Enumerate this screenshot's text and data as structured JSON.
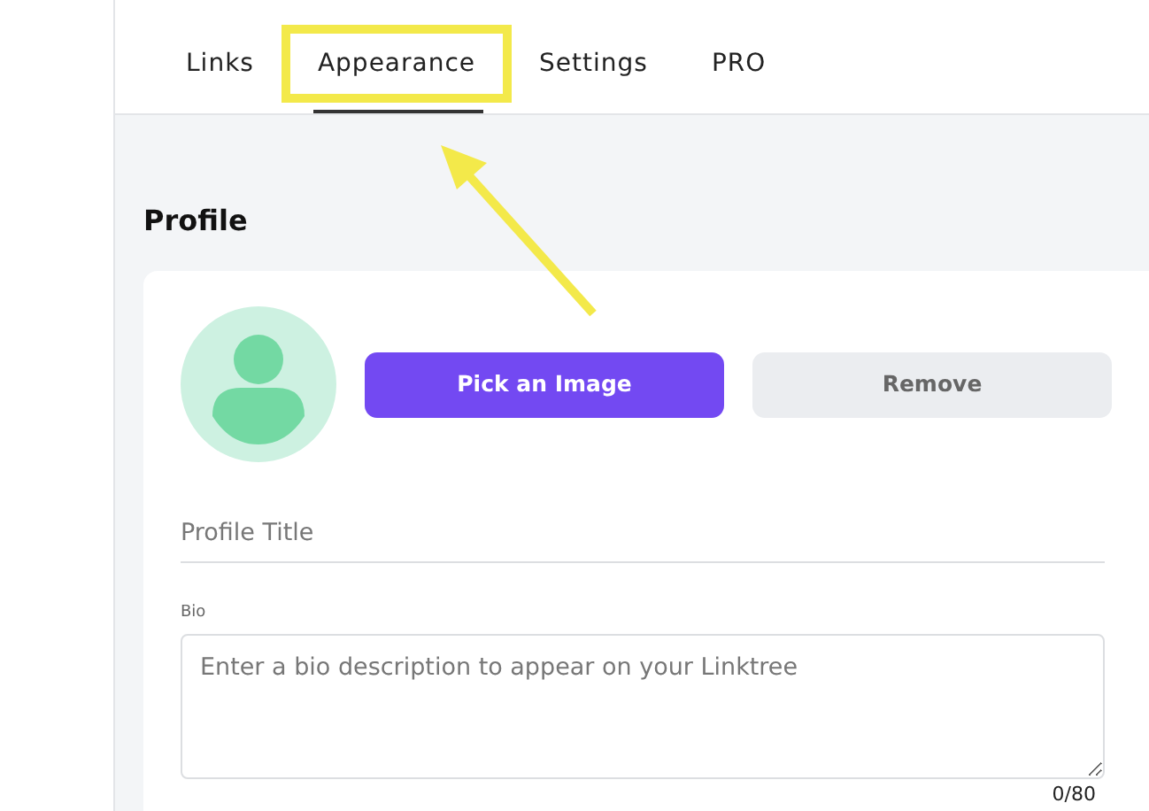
{
  "tabs": [
    {
      "label": "Links",
      "selected": false,
      "highlighted": false
    },
    {
      "label": "Appearance",
      "selected": true,
      "highlighted": true
    },
    {
      "label": "Settings",
      "selected": false,
      "highlighted": false
    },
    {
      "label": "PRO",
      "selected": false,
      "highlighted": false
    }
  ],
  "profile": {
    "heading": "Profile",
    "pick_button": "Pick an Image",
    "remove_button": "Remove",
    "title_field": {
      "placeholder": "Profile Title"
    },
    "bio": {
      "label": "Bio",
      "placeholder": "Enter a bio description to appear on your Linktree",
      "counter": "0/80"
    }
  }
}
